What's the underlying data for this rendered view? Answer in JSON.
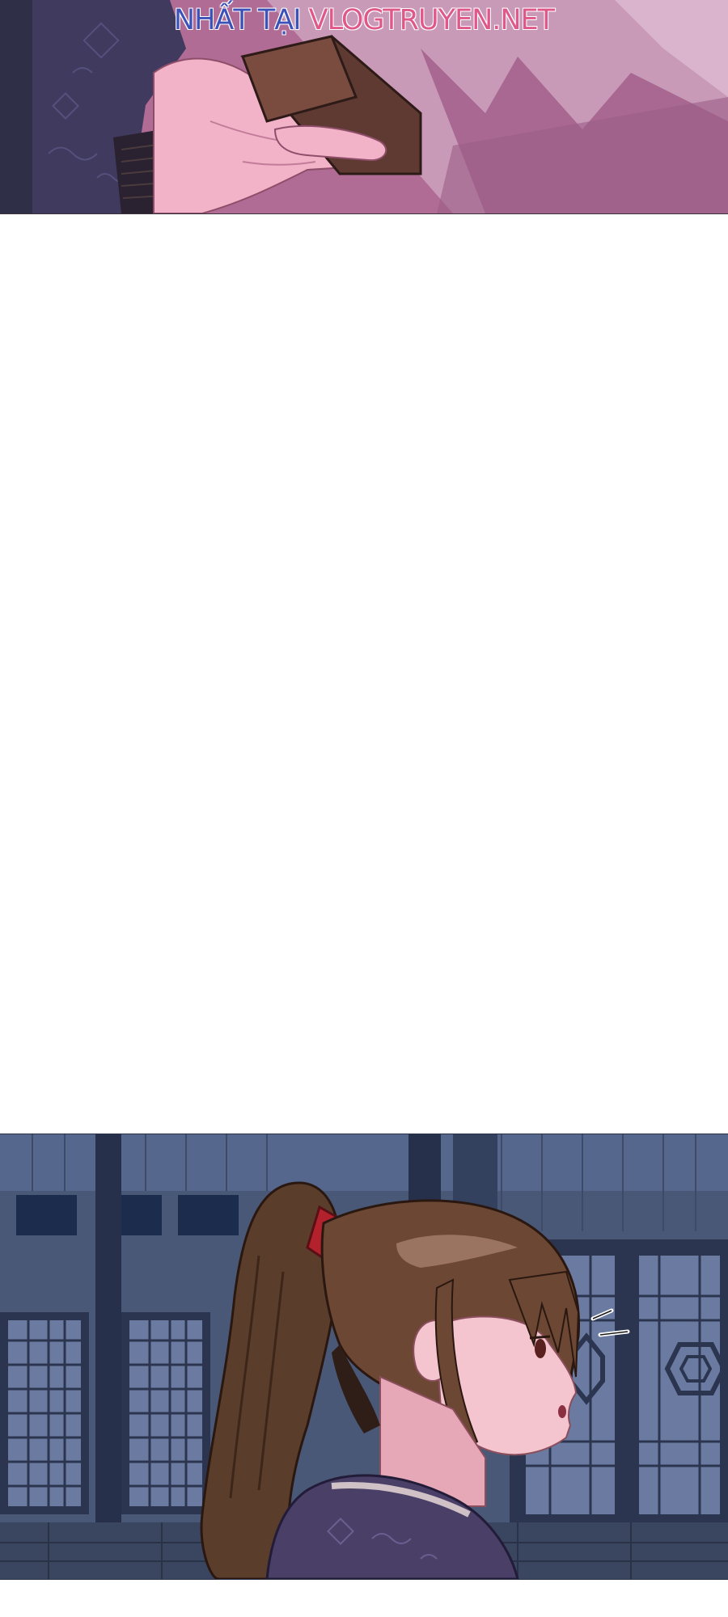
{
  "watermark": {
    "prefix": "NHẤT TẠI ",
    "site": "VLOGTRUYEN.NET"
  },
  "panels": [
    {
      "subject": "hand-holding-box"
    },
    {
      "subject": "girl-with-ponytail-surprised"
    }
  ],
  "colors": {
    "sleeve": "#3f3a5e",
    "skin_top": "#f2b3c8",
    "box": "#5e3a32",
    "background_top": "#b5739a",
    "wall": "#4a5878",
    "hair": "#5b3d2c",
    "ribbon": "#b3222c",
    "robe": "#4a3f66"
  },
  "surprise_marks": "surprise-lines-icon"
}
